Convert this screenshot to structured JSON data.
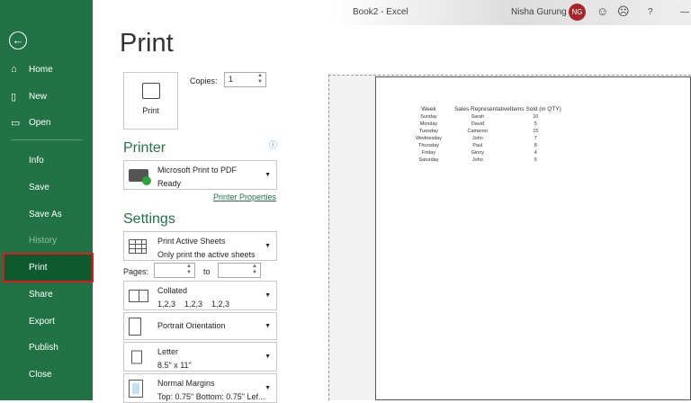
{
  "window": {
    "title": "Book2  -  Excel",
    "user": "Nisha Gurung",
    "initials": "NG",
    "help": "?",
    "minimize": "—"
  },
  "sidebar": {
    "items": [
      {
        "label": "Home",
        "icon": "⌂"
      },
      {
        "label": "New",
        "icon": "▯"
      },
      {
        "label": "Open",
        "icon": "▭"
      },
      {
        "label": "Info"
      },
      {
        "label": "Save"
      },
      {
        "label": "Save As"
      },
      {
        "label": "History"
      },
      {
        "label": "Print"
      },
      {
        "label": "Share"
      },
      {
        "label": "Export"
      },
      {
        "label": "Publish"
      },
      {
        "label": "Close"
      }
    ]
  },
  "print": {
    "title": "Print",
    "button": "Print",
    "copies_label": "Copies:",
    "copies": "1"
  },
  "printer": {
    "heading": "Printer",
    "name": "Microsoft Print to PDF",
    "status": "Ready",
    "properties": "Printer Properties"
  },
  "settings": {
    "heading": "Settings",
    "pages_label": "Pages:",
    "to_label": "to",
    "sheets": {
      "l1": "Print Active Sheets",
      "l2": "Only print the active sheets"
    },
    "collate": {
      "l1": "Collated",
      "l2": "1,2,3    1,2,3    1,2,3"
    },
    "orientation": {
      "l1": "Portrait Orientation"
    },
    "paper": {
      "l1": "Letter",
      "l2": "8.5\" x 11\""
    },
    "margins": {
      "l1": "Normal Margins",
      "l2": "Top: 0.75\" Bottom: 0.75\" Lef..."
    }
  },
  "sheet": {
    "headers": [
      "Week",
      "Sales Representative",
      "Items Sold (in QTY)"
    ],
    "rows": [
      [
        "Sunday",
        "Sarah",
        "10"
      ],
      [
        "Monday",
        "David",
        "5"
      ],
      [
        "Tuesday",
        "Cameron",
        "15"
      ],
      [
        "Wednesday",
        "John",
        "7"
      ],
      [
        "Thursday",
        "Paul",
        "8"
      ],
      [
        "Friday",
        "Ginny",
        "4"
      ],
      [
        "Saturday",
        "John",
        "6"
      ]
    ]
  }
}
